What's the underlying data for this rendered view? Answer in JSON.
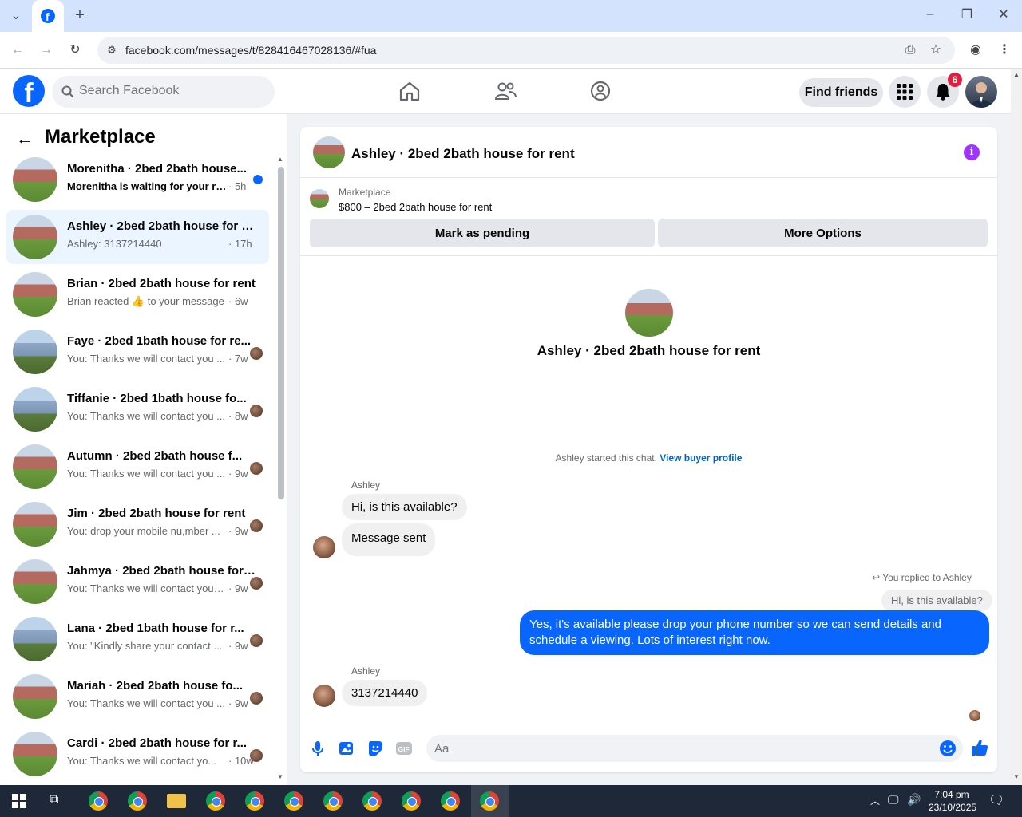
{
  "browser": {
    "url": "facebook.com/messages/t/828416467028136/#fua"
  },
  "header": {
    "search_placeholder": "Search Facebook",
    "find_friends": "Find friends",
    "notifications_count": "6"
  },
  "sidebar": {
    "title": "Marketplace",
    "conversations": [
      {
        "title": "Morenitha · 2bed 2bath house...",
        "sub": "Morenitha is waiting for your re...",
        "time": "· 5h",
        "unread": true,
        "thumb": "brick"
      },
      {
        "title": "Ashley · 2bed 2bath house for re...",
        "sub": "Ashley: 3137214440",
        "time": "· 17h",
        "active": true,
        "thumb": "brick"
      },
      {
        "title": "Brian · 2bed 2bath house for rent",
        "sub": "Brian reacted 👍 to your message",
        "time": "· 6w",
        "thumb": "brick"
      },
      {
        "title": "Faye · 2bed 1bath house for re...",
        "sub": "You: Thanks we will contact you ...",
        "time": "· 7w",
        "thumb": "blue"
      },
      {
        "title": "Tiffanie · 2bed 1bath house fo...",
        "sub": "You: Thanks we will contact you ...",
        "time": "· 8w",
        "thumb": "blue"
      },
      {
        "title": "Autumn · 2bed 2bath house f...",
        "sub": "You: Thanks we will contact you ...",
        "time": "· 9w",
        "thumb": "brick"
      },
      {
        "title": "Jim · 2bed 2bath house for rent",
        "sub": "You: drop your mobile nu,mber ...",
        "time": "· 9w",
        "thumb": "brick"
      },
      {
        "title": "Jahmya · 2bed 2bath house for r...",
        "sub": "You: Thanks we will contact you so...",
        "time": "· 9w",
        "thumb": "brick"
      },
      {
        "title": "Lana · 2bed 1bath house for r...",
        "sub": "You: \"Kindly share your contact ...",
        "time": "· 9w",
        "thumb": "blue"
      },
      {
        "title": "Mariah · 2bed 2bath house fo...",
        "sub": "You: Thanks we will contact you ...",
        "time": "· 9w",
        "thumb": "brick"
      },
      {
        "title": "Cardi · 2bed 2bath house for r...",
        "sub": "You: Thanks we will contact yo...",
        "time": "· 10w",
        "thumb": "brick"
      }
    ]
  },
  "chat": {
    "title": "Ashley · 2bed 2bath house for rent",
    "listing_category": "Marketplace",
    "listing_price": "$800 – 2bed 2bath house for rent",
    "mark_pending": "Mark as pending",
    "more_options": "More Options",
    "center_title": "Ashley · 2bed 2bath house for rent",
    "started_text": "Ashley started this chat.",
    "view_buyer": "View buyer profile",
    "sender1": "Ashley",
    "msg1": "Hi, is this available?",
    "msg2": "Message sent",
    "replied_to": "You replied to Ashley",
    "reply_quote": "Hi, is this available?",
    "msg_out": "Yes, it's available please drop your phone number so we can send details and schedule a viewing. Lots of interest right now.",
    "sender2": "Ashley",
    "msg3": "3137214440",
    "composer_placeholder": "Aa"
  },
  "taskbar": {
    "time": "7:04 pm",
    "date": "23/10/2025"
  },
  "colors": {
    "brand_blue": "#0866ff",
    "badge_red": "#e41e3f",
    "info_purple": "#a033ff"
  }
}
